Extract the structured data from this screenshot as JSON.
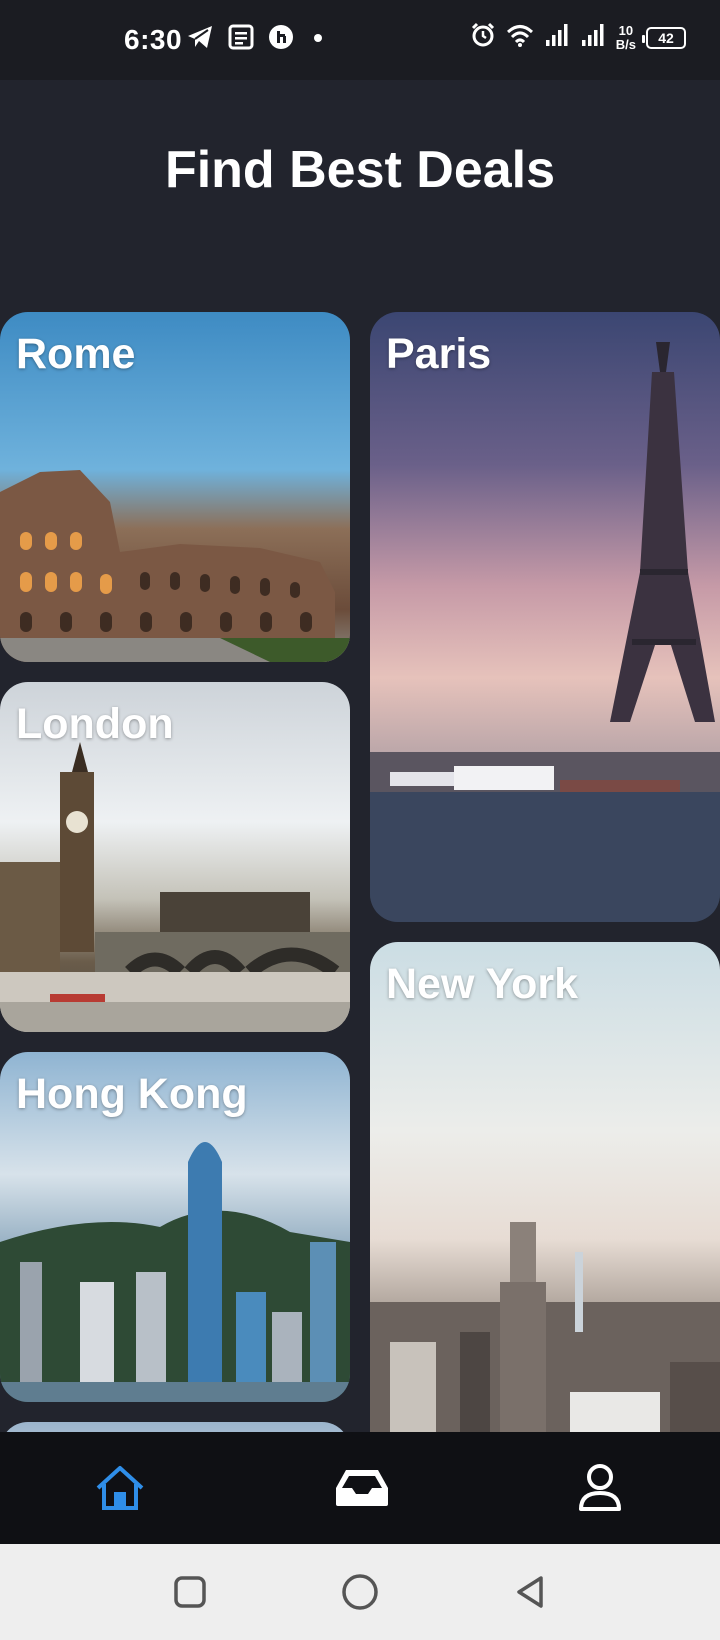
{
  "status_bar": {
    "time": "6:30",
    "net_speed_value": "10",
    "net_speed_unit": "B/s",
    "battery": "42",
    "left_icons": [
      "telegram-icon",
      "news-icon",
      "app-icon",
      "dot-icon"
    ],
    "right_icons": [
      "alarm-icon",
      "wifi-icon",
      "signal-icon",
      "signal-icon"
    ]
  },
  "header": {
    "title": "Find Best Deals"
  },
  "destinations": [
    {
      "name": "Rome"
    },
    {
      "name": "Paris"
    },
    {
      "name": "London"
    },
    {
      "name": "New York"
    },
    {
      "name": "Hong Kong"
    }
  ],
  "bottom_nav": {
    "active": "home",
    "active_color": "#2f8ee8",
    "items": [
      "home-icon",
      "inbox-icon",
      "profile-icon"
    ]
  },
  "system_nav": {
    "buttons": [
      "recents-icon",
      "home-circle-icon",
      "back-icon"
    ]
  }
}
